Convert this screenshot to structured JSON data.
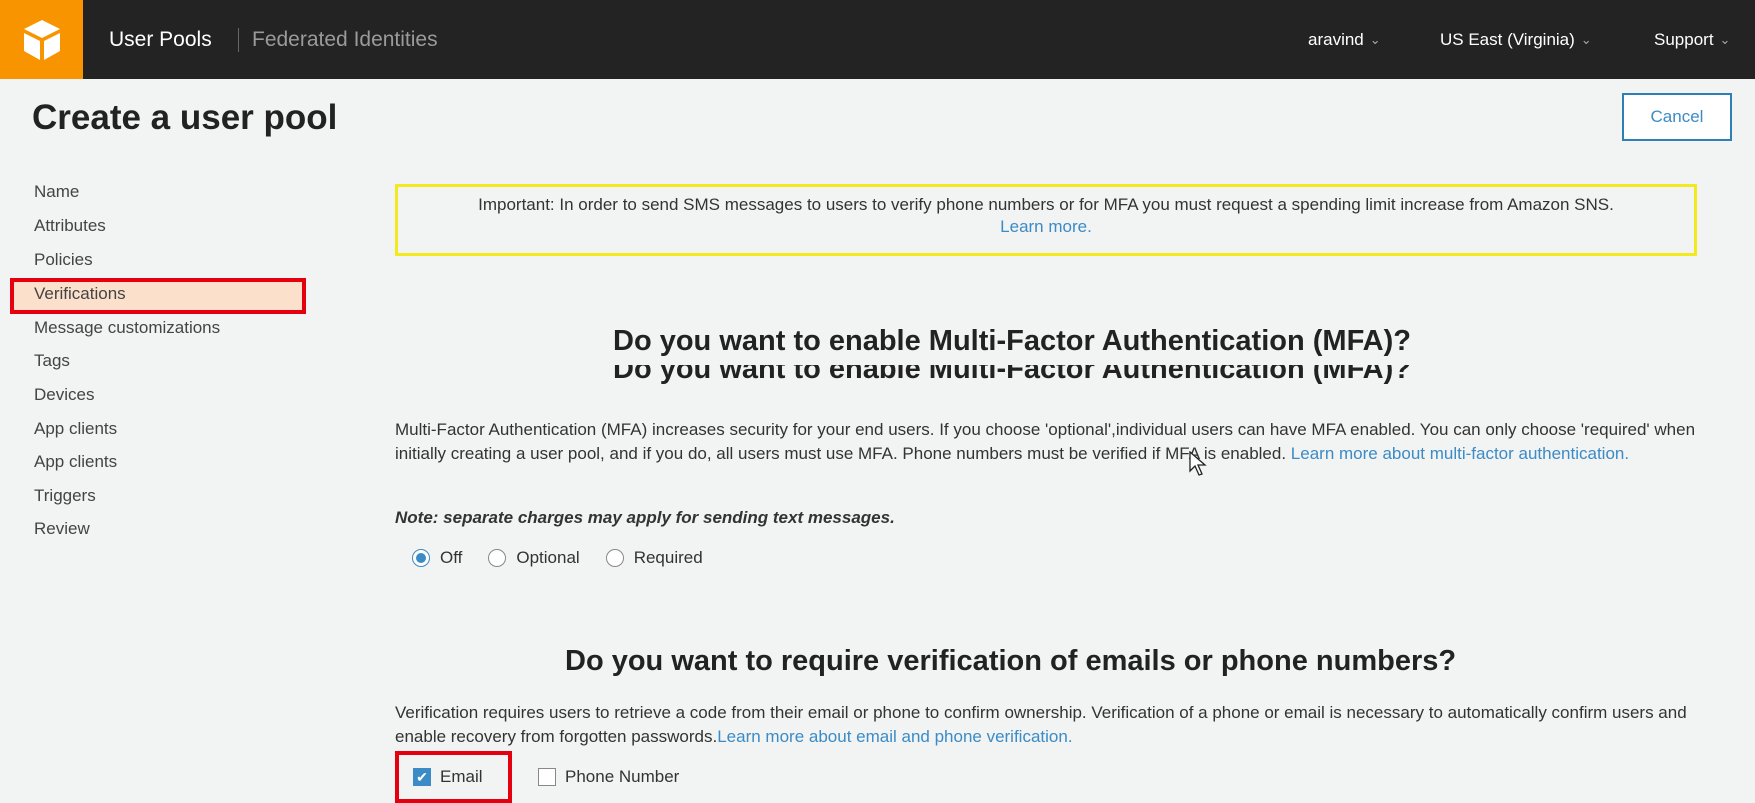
{
  "topbar": {
    "nav_userpools": "User Pools",
    "nav_federated": "Federated Identities",
    "user": "aravind",
    "region": "US East (Virginia)",
    "support": "Support"
  },
  "header": {
    "title": "Create a user pool",
    "cancel": "Cancel"
  },
  "sidebar": {
    "items": [
      {
        "label": "Name"
      },
      {
        "label": "Attributes"
      },
      {
        "label": "Policies"
      },
      {
        "label": "Verifications"
      },
      {
        "label": "Message customizations"
      },
      {
        "label": "Tags"
      },
      {
        "label": "Devices"
      },
      {
        "label": "App clients"
      },
      {
        "label": "App clients"
      },
      {
        "label": "Triggers"
      },
      {
        "label": "Review"
      }
    ],
    "active_index": 3
  },
  "notice": {
    "text": "Important: In order to send SMS messages to users to verify phone numbers or for MFA you must request a spending limit increase from Amazon SNS.",
    "link": "Learn more."
  },
  "mfa": {
    "heading": "Do you want to enable Multi-Factor Authentication (MFA)?",
    "description": "Multi-Factor Authentication (MFA) increases security for your end users. If you choose 'optional',individual users can have MFA enabled. You can only choose 'required' when initially creating a user pool, and if you do, all users must use MFA. Phone numbers must be verified if MFA is enabled.",
    "link": "Learn more about multi-factor authentication.",
    "note": "Note: separate charges may apply for sending text messages.",
    "options": [
      "Off",
      "Optional",
      "Required"
    ],
    "selected": "Off"
  },
  "verification": {
    "heading": "Do you want to require verification of emails or phone numbers?",
    "description": "Verification requires users to retrieve a code from their email or phone to confirm ownership. Verification of a phone or email is necessary to automatically confirm users and enable recovery from forgotten passwords.",
    "link": "Learn more about email and phone verification.",
    "email_label": "Email",
    "email_checked": true,
    "phone_label": "Phone Number",
    "phone_checked": false
  },
  "colors": {
    "topbar": "#232323",
    "logo": "#f79400",
    "accent": "#3b8bc6",
    "highlight_red": "#e5000f",
    "notice_border": "#f2ea1f"
  }
}
